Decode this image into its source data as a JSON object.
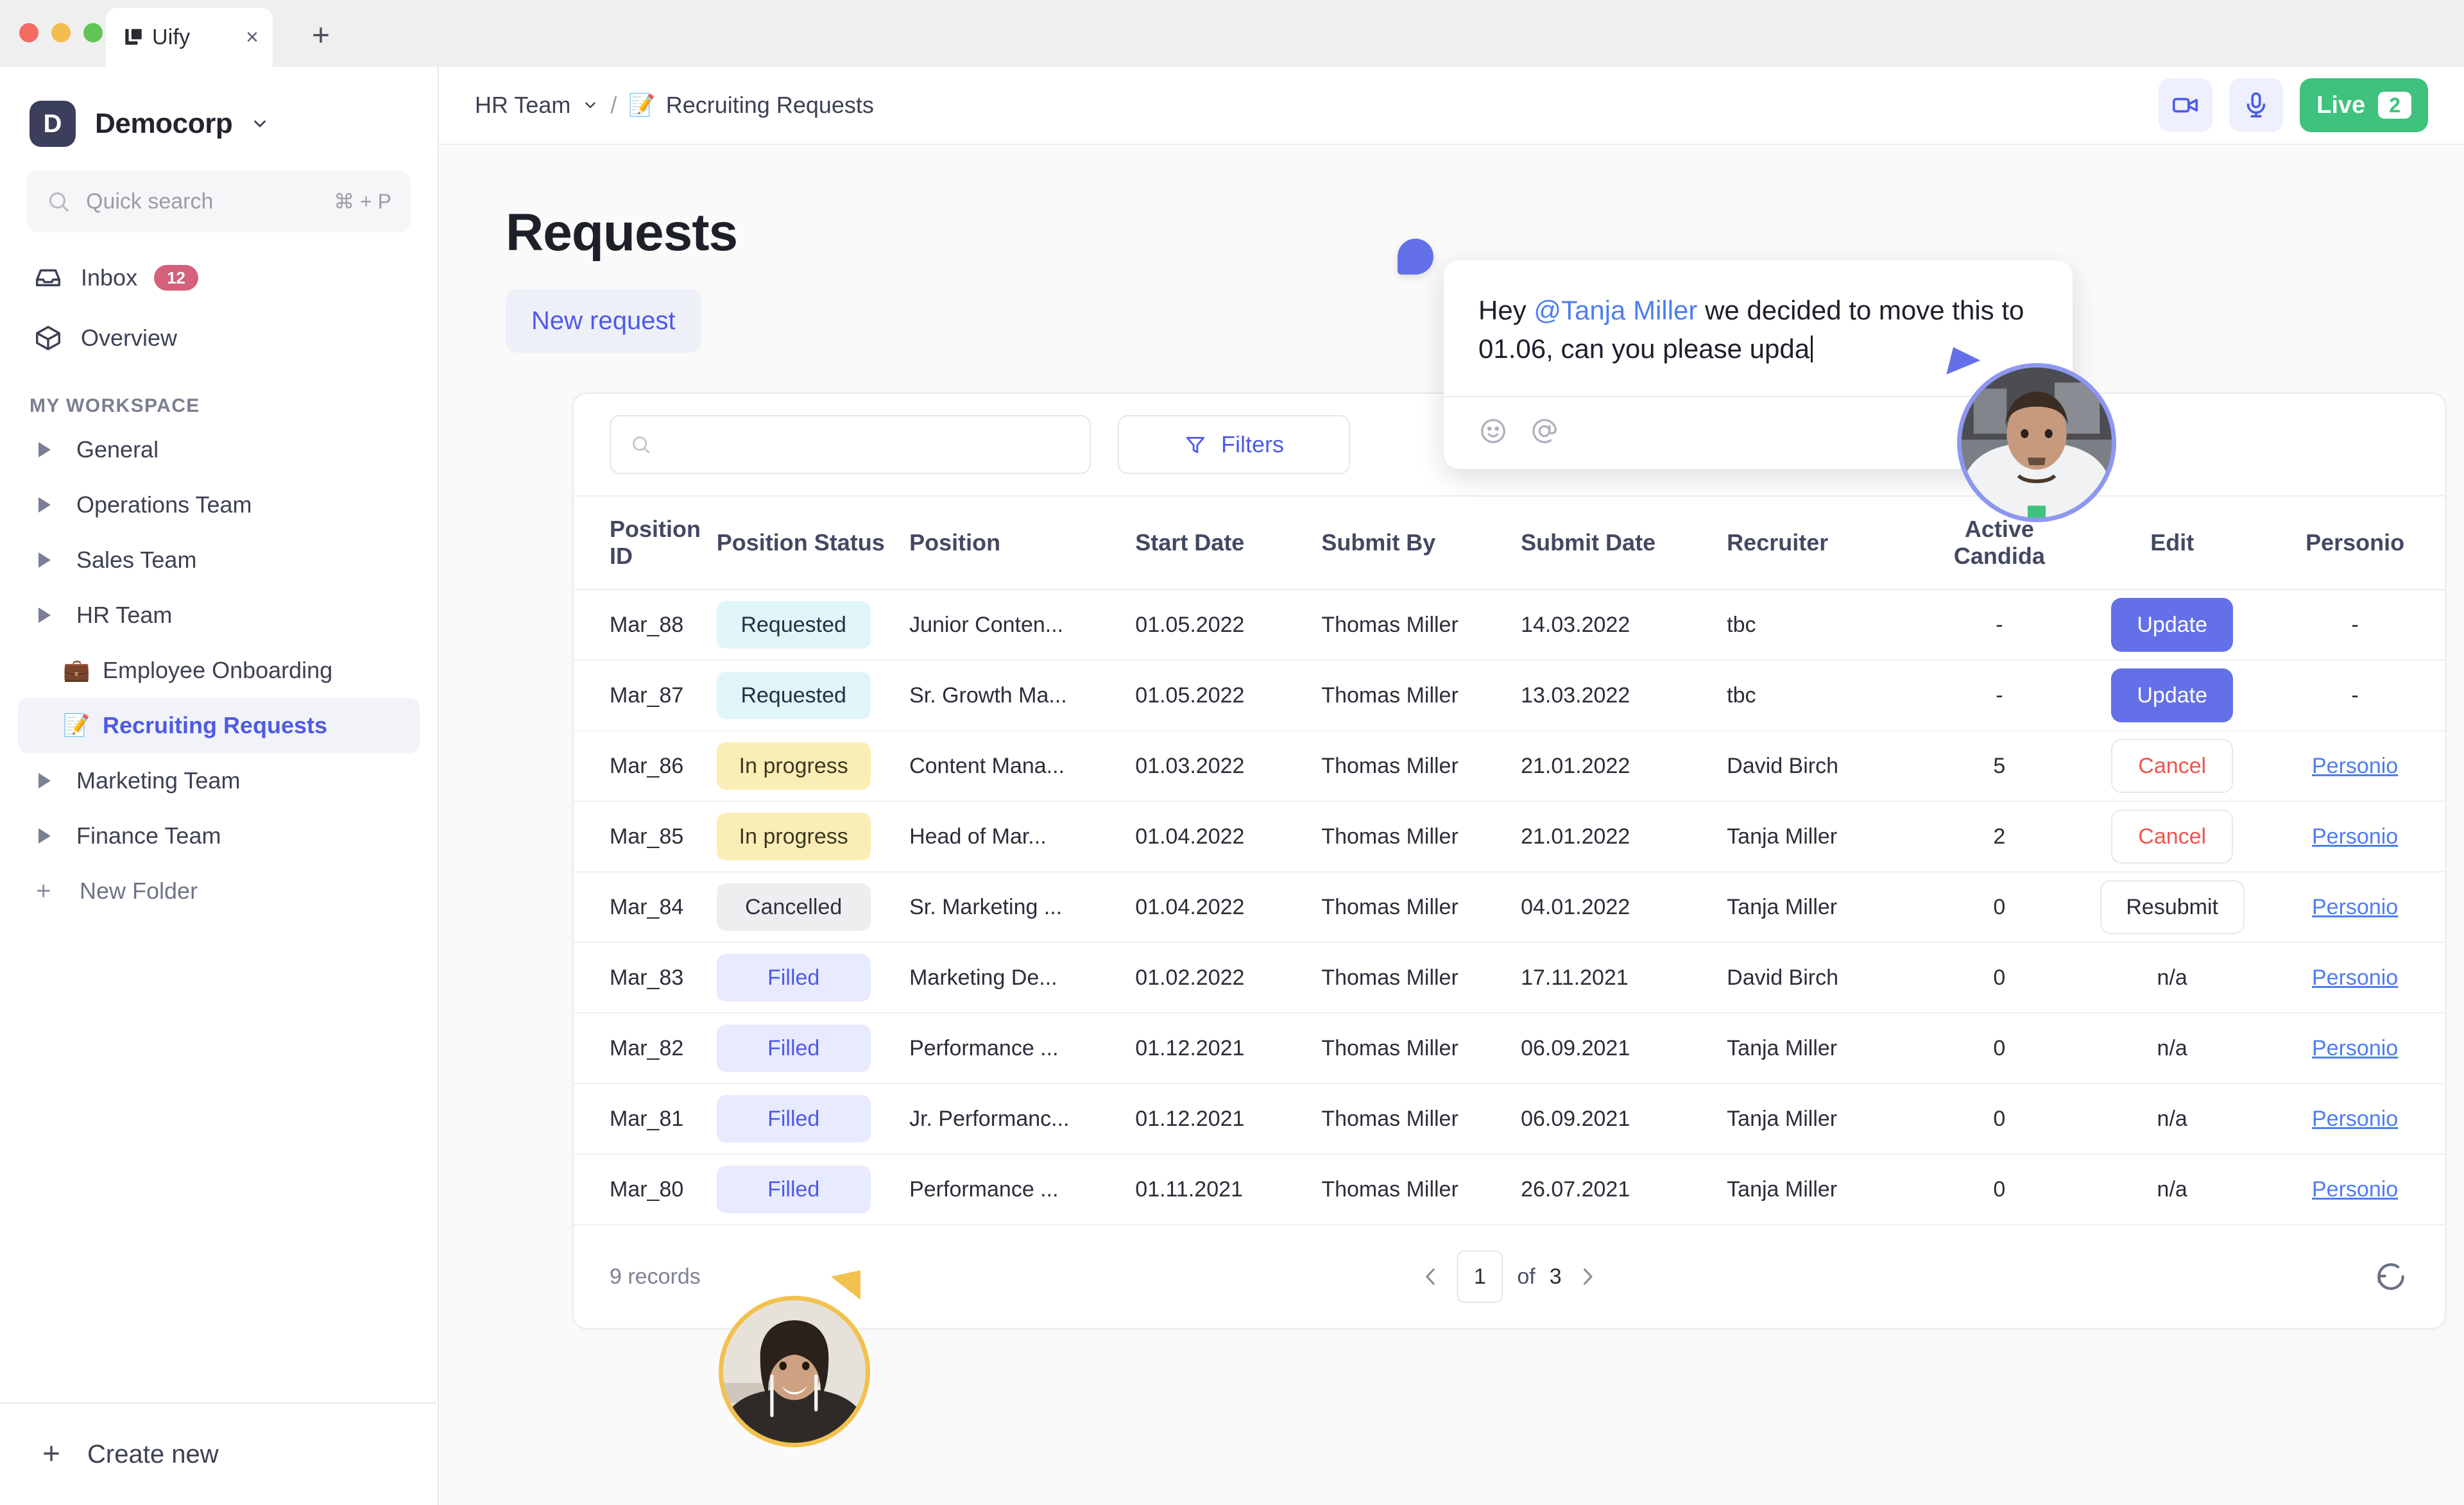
{
  "browser": {
    "tab_title": "Uify",
    "tab_favicon_name": "uify-logo-icon",
    "close_label": "×",
    "new_tab_label": "+"
  },
  "sidebar": {
    "workspace": {
      "initial": "D",
      "name": "Democorp"
    },
    "search": {
      "placeholder": "Quick search",
      "shortcut": "⌘ + P"
    },
    "nav": [
      {
        "label": "Inbox",
        "badge": "12",
        "icon": "inbox-icon"
      },
      {
        "label": "Overview",
        "icon": "cube-icon"
      }
    ],
    "section_header": "MY WORKSPACE",
    "tree": [
      {
        "label": "General",
        "type": "folder"
      },
      {
        "label": "Operations Team",
        "type": "folder"
      },
      {
        "label": "Sales Team",
        "type": "folder"
      },
      {
        "label": "HR Team",
        "type": "folder"
      },
      {
        "label": "Employee Onboarding",
        "type": "page",
        "emoji": "💼"
      },
      {
        "label": "Recruiting Requests",
        "type": "page",
        "emoji": "📝",
        "active": true
      },
      {
        "label": "Marketing Team",
        "type": "folder"
      },
      {
        "label": "Finance Team",
        "type": "folder"
      }
    ],
    "new_folder_label": "New Folder",
    "create_new_label": "Create new"
  },
  "topbar": {
    "breadcrumb_team": "HR Team",
    "breadcrumb_separator": "/",
    "breadcrumb_emoji": "📝",
    "breadcrumb_page": "Recruiting Requests",
    "video_icon": "video-camera-icon",
    "mic_icon": "microphone-icon",
    "live_label": "Live",
    "live_count": "2"
  },
  "page": {
    "title": "Requests",
    "new_request_label": "New request"
  },
  "toolbar": {
    "search_value": "",
    "search_placeholder": "",
    "filters_label": "Filters"
  },
  "table": {
    "columns": [
      "Position ID",
      "Position Status",
      "Position",
      "Start Date",
      "Submit By",
      "Submit Date",
      "Recruiter",
      "Active Candida",
      "Edit",
      "Personio"
    ],
    "rows": [
      {
        "position_id": "Mar_88",
        "status": "Requested",
        "status_kind": "requested",
        "position": "Junior Conten...",
        "start_date": "01.05.2022",
        "submit_by": "Thomas Miller",
        "submit_date": "14.03.2022",
        "recruiter": "tbc",
        "active_candidates": "-",
        "edit": "Update",
        "edit_kind": "update",
        "personio": "-",
        "personio_kind": "dash"
      },
      {
        "position_id": "Mar_87",
        "status": "Requested",
        "status_kind": "requested",
        "position": "Sr. Growth Ma...",
        "start_date": "01.05.2022",
        "submit_by": "Thomas Miller",
        "submit_date": "13.03.2022",
        "recruiter": "tbc",
        "active_candidates": "-",
        "edit": "Update",
        "edit_kind": "update",
        "personio": "-",
        "personio_kind": "dash"
      },
      {
        "position_id": "Mar_86",
        "status": "In progress",
        "status_kind": "inprogress",
        "position": "Content Mana...",
        "start_date": "01.03.2022",
        "submit_by": "Thomas Miller",
        "submit_date": "21.01.2022",
        "recruiter": "David Birch",
        "active_candidates": "5",
        "edit": "Cancel",
        "edit_kind": "cancel",
        "personio": "Personio",
        "personio_kind": "link"
      },
      {
        "position_id": "Mar_85",
        "status": "In progress",
        "status_kind": "inprogress",
        "position": "Head of Mar...",
        "start_date": "01.04.2022",
        "submit_by": "Thomas Miller",
        "submit_date": "21.01.2022",
        "recruiter": "Tanja Miller",
        "active_candidates": "2",
        "edit": "Cancel",
        "edit_kind": "cancel",
        "personio": "Personio",
        "personio_kind": "link"
      },
      {
        "position_id": "Mar_84",
        "status": "Cancelled",
        "status_kind": "cancelled",
        "position": "Sr. Marketing ...",
        "start_date": "01.04.2022",
        "submit_by": "Thomas Miller",
        "submit_date": "04.01.2022",
        "recruiter": "Tanja Miller",
        "active_candidates": "0",
        "edit": "Resubmit",
        "edit_kind": "resubmit",
        "personio": "Personio",
        "personio_kind": "link"
      },
      {
        "position_id": "Mar_83",
        "status": "Filled",
        "status_kind": "filled",
        "position": "Marketing De...",
        "start_date": "01.02.2022",
        "submit_by": "Thomas Miller",
        "submit_date": "17.11.2021",
        "recruiter": "David Birch",
        "active_candidates": "0",
        "edit": "n/a",
        "edit_kind": "na",
        "personio": "Personio",
        "personio_kind": "link"
      },
      {
        "position_id": "Mar_82",
        "status": "Filled",
        "status_kind": "filled",
        "position": "Performance ...",
        "start_date": "01.12.2021",
        "submit_by": "Thomas Miller",
        "submit_date": "06.09.2021",
        "recruiter": "Tanja Miller",
        "active_candidates": "0",
        "edit": "n/a",
        "edit_kind": "na",
        "personio": "Personio",
        "personio_kind": "link"
      },
      {
        "position_id": "Mar_81",
        "status": "Filled",
        "status_kind": "filled",
        "position": "Jr. Performanc...",
        "start_date": "01.12.2021",
        "submit_by": "Thomas Miller",
        "submit_date": "06.09.2021",
        "recruiter": "Tanja Miller",
        "active_candidates": "0",
        "edit": "n/a",
        "edit_kind": "na",
        "personio": "Personio",
        "personio_kind": "link"
      },
      {
        "position_id": "Mar_80",
        "status": "Filled",
        "status_kind": "filled",
        "position": "Performance ...",
        "start_date": "01.11.2021",
        "submit_by": "Thomas Miller",
        "submit_date": "26.07.2021",
        "recruiter": "Tanja Miller",
        "active_candidates": "0",
        "edit": "n/a",
        "edit_kind": "na",
        "personio": "Personio",
        "personio_kind": "link"
      }
    ]
  },
  "footer": {
    "records_label": "9 records",
    "page_current": "1",
    "page_of_label": "of",
    "page_total": "3",
    "refresh_icon": "refresh-icon"
  },
  "collaboration": {
    "comment": {
      "text_before": "Hey ",
      "mention": "@Tanja Miller",
      "text_after": " we decided to move this to 01.06, can you please upda",
      "emoji_tool": "emoji-icon",
      "mention_tool": "at-mention-icon"
    },
    "presence": [
      {
        "name": "male-participant",
        "ring_color": "#8d97f0"
      },
      {
        "name": "female-participant",
        "ring_color": "#f2c14e"
      }
    ]
  },
  "colors": {
    "accent": "#4d5ae8",
    "accent_button": "#6470e8",
    "live_green": "#3ec27d",
    "badge_inbox": "#d4607a",
    "danger": "#f0544c",
    "link": "#4d7ef0",
    "cursor_blue": "#6470e8",
    "cursor_yellow": "#f2c14e"
  }
}
